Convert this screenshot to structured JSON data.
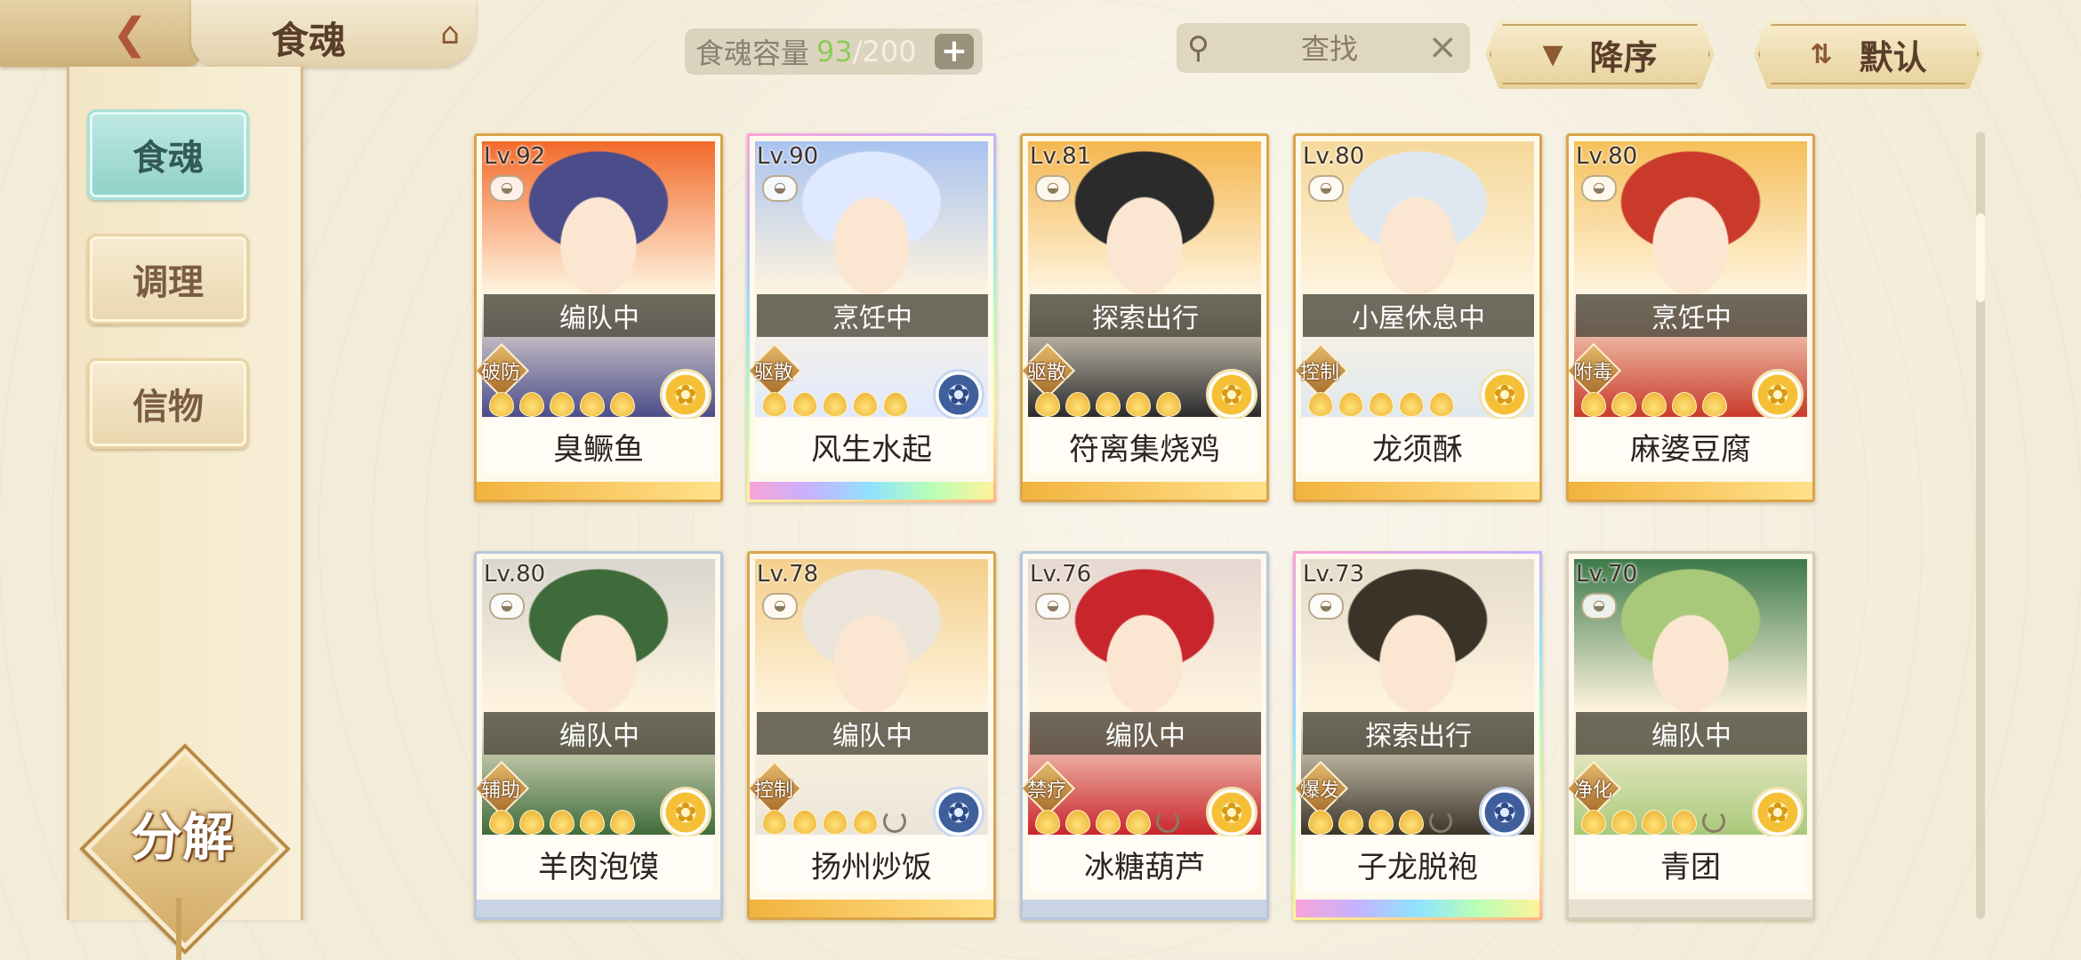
{
  "header": {
    "title": "食魂",
    "capacity_label": "食魂容量",
    "capacity_current": "93",
    "capacity_max": "/200",
    "search_placeholder": "查找",
    "sort_order_label": "降序",
    "sort_default_label": "默认"
  },
  "sidebar": {
    "items": [
      {
        "label": "食魂",
        "active": true
      },
      {
        "label": "调理",
        "active": false
      },
      {
        "label": "信物",
        "active": false
      }
    ],
    "decompose_label": "分解"
  },
  "cards": [
    {
      "level": "Lv.92",
      "status": "编队中",
      "role": "破防",
      "stars": 5,
      "name": "臭鳜鱼",
      "border": "gold",
      "flower": "gold",
      "palette": [
        "#f26a2b",
        "#4b4c8a"
      ]
    },
    {
      "level": "Lv.90",
      "status": "烹饪中",
      "role": "驱散",
      "stars": 5,
      "name": "风生水起",
      "border": "rainbow",
      "flower": "blue",
      "palette": [
        "#a9c3f0",
        "#dfe9ff"
      ]
    },
    {
      "level": "Lv.81",
      "status": "探索出行",
      "role": "驱散",
      "stars": 5,
      "name": "符离集烧鸡",
      "border": "gold",
      "flower": "gold",
      "palette": [
        "#f4b650",
        "#2b2b2b"
      ]
    },
    {
      "level": "Lv.80",
      "status": "小屋休息中",
      "role": "控制",
      "stars": 5,
      "name": "龙须酥",
      "border": "gold",
      "flower": "gold",
      "palette": [
        "#f5d89a",
        "#dfe8f0"
      ]
    },
    {
      "level": "Lv.80",
      "status": "烹饪中",
      "role": "附毒",
      "stars": 5,
      "name": "麻婆豆腐",
      "border": "gold",
      "flower": "gold",
      "palette": [
        "#f5c05a",
        "#c93a2a"
      ]
    },
    {
      "level": "Lv.80",
      "status": "编队中",
      "role": "辅助",
      "stars": 5,
      "name": "羊肉泡馍",
      "border": "blue",
      "flower": "gold",
      "palette": [
        "#d9d6cf",
        "#3f6b3a"
      ]
    },
    {
      "level": "Lv.78",
      "status": "编队中",
      "role": "控制",
      "stars": 4,
      "name": "扬州炒饭",
      "border": "gold",
      "flower": "blue",
      "palette": [
        "#f3cf8a",
        "#eae4da"
      ]
    },
    {
      "level": "Lv.76",
      "status": "编队中",
      "role": "禁疗",
      "stars": 4,
      "name": "冰糖葫芦",
      "border": "blue",
      "flower": "gold",
      "palette": [
        "#e7d7d2",
        "#c8252c"
      ]
    },
    {
      "level": "Lv.73",
      "status": "探索出行",
      "role": "爆发",
      "stars": 4,
      "name": "子龙脱袍",
      "border": "rainbow",
      "flower": "blue",
      "palette": [
        "#e6dccb",
        "#3a3428"
      ]
    },
    {
      "level": "Lv.70",
      "status": "编队中",
      "role": "净化",
      "stars": 4,
      "name": "青团",
      "border": "plain",
      "flower": "gold",
      "palette": [
        "#3d7a4a",
        "#a9c97a"
      ]
    }
  ]
}
